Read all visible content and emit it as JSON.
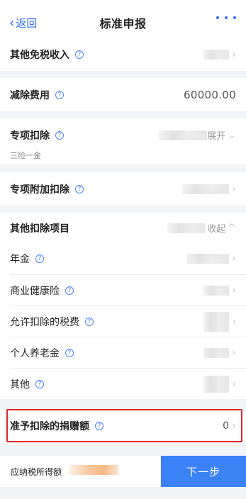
{
  "nav": {
    "back_label": "返回",
    "title": "标准申报"
  },
  "rows": {
    "other_exempt": {
      "label": "其他免税收入"
    },
    "deduction_fee": {
      "label": "减除费用",
      "value": "60000.00"
    },
    "special": {
      "label": "专项扣除",
      "caption": "三险一金",
      "toggle": "展开"
    },
    "special_additional": {
      "label": "专项附加扣除"
    },
    "other_items": {
      "label": "其他扣除项目",
      "toggle": "收起"
    },
    "annuity": {
      "label": "年金"
    },
    "health_insurance": {
      "label": "商业健康险"
    },
    "deductible_tax": {
      "label": "允许扣除的税费"
    },
    "personal_pension": {
      "label": "个人养老金"
    },
    "other": {
      "label": "其他"
    },
    "donation": {
      "label": "准予扣除的捐赠额",
      "value": "0"
    }
  },
  "footer": {
    "taxable_income_label": "应纳税所得额",
    "next_button": "下一步"
  },
  "colors": {
    "accent": "#3b82f6",
    "highlight": "#e0262d"
  }
}
